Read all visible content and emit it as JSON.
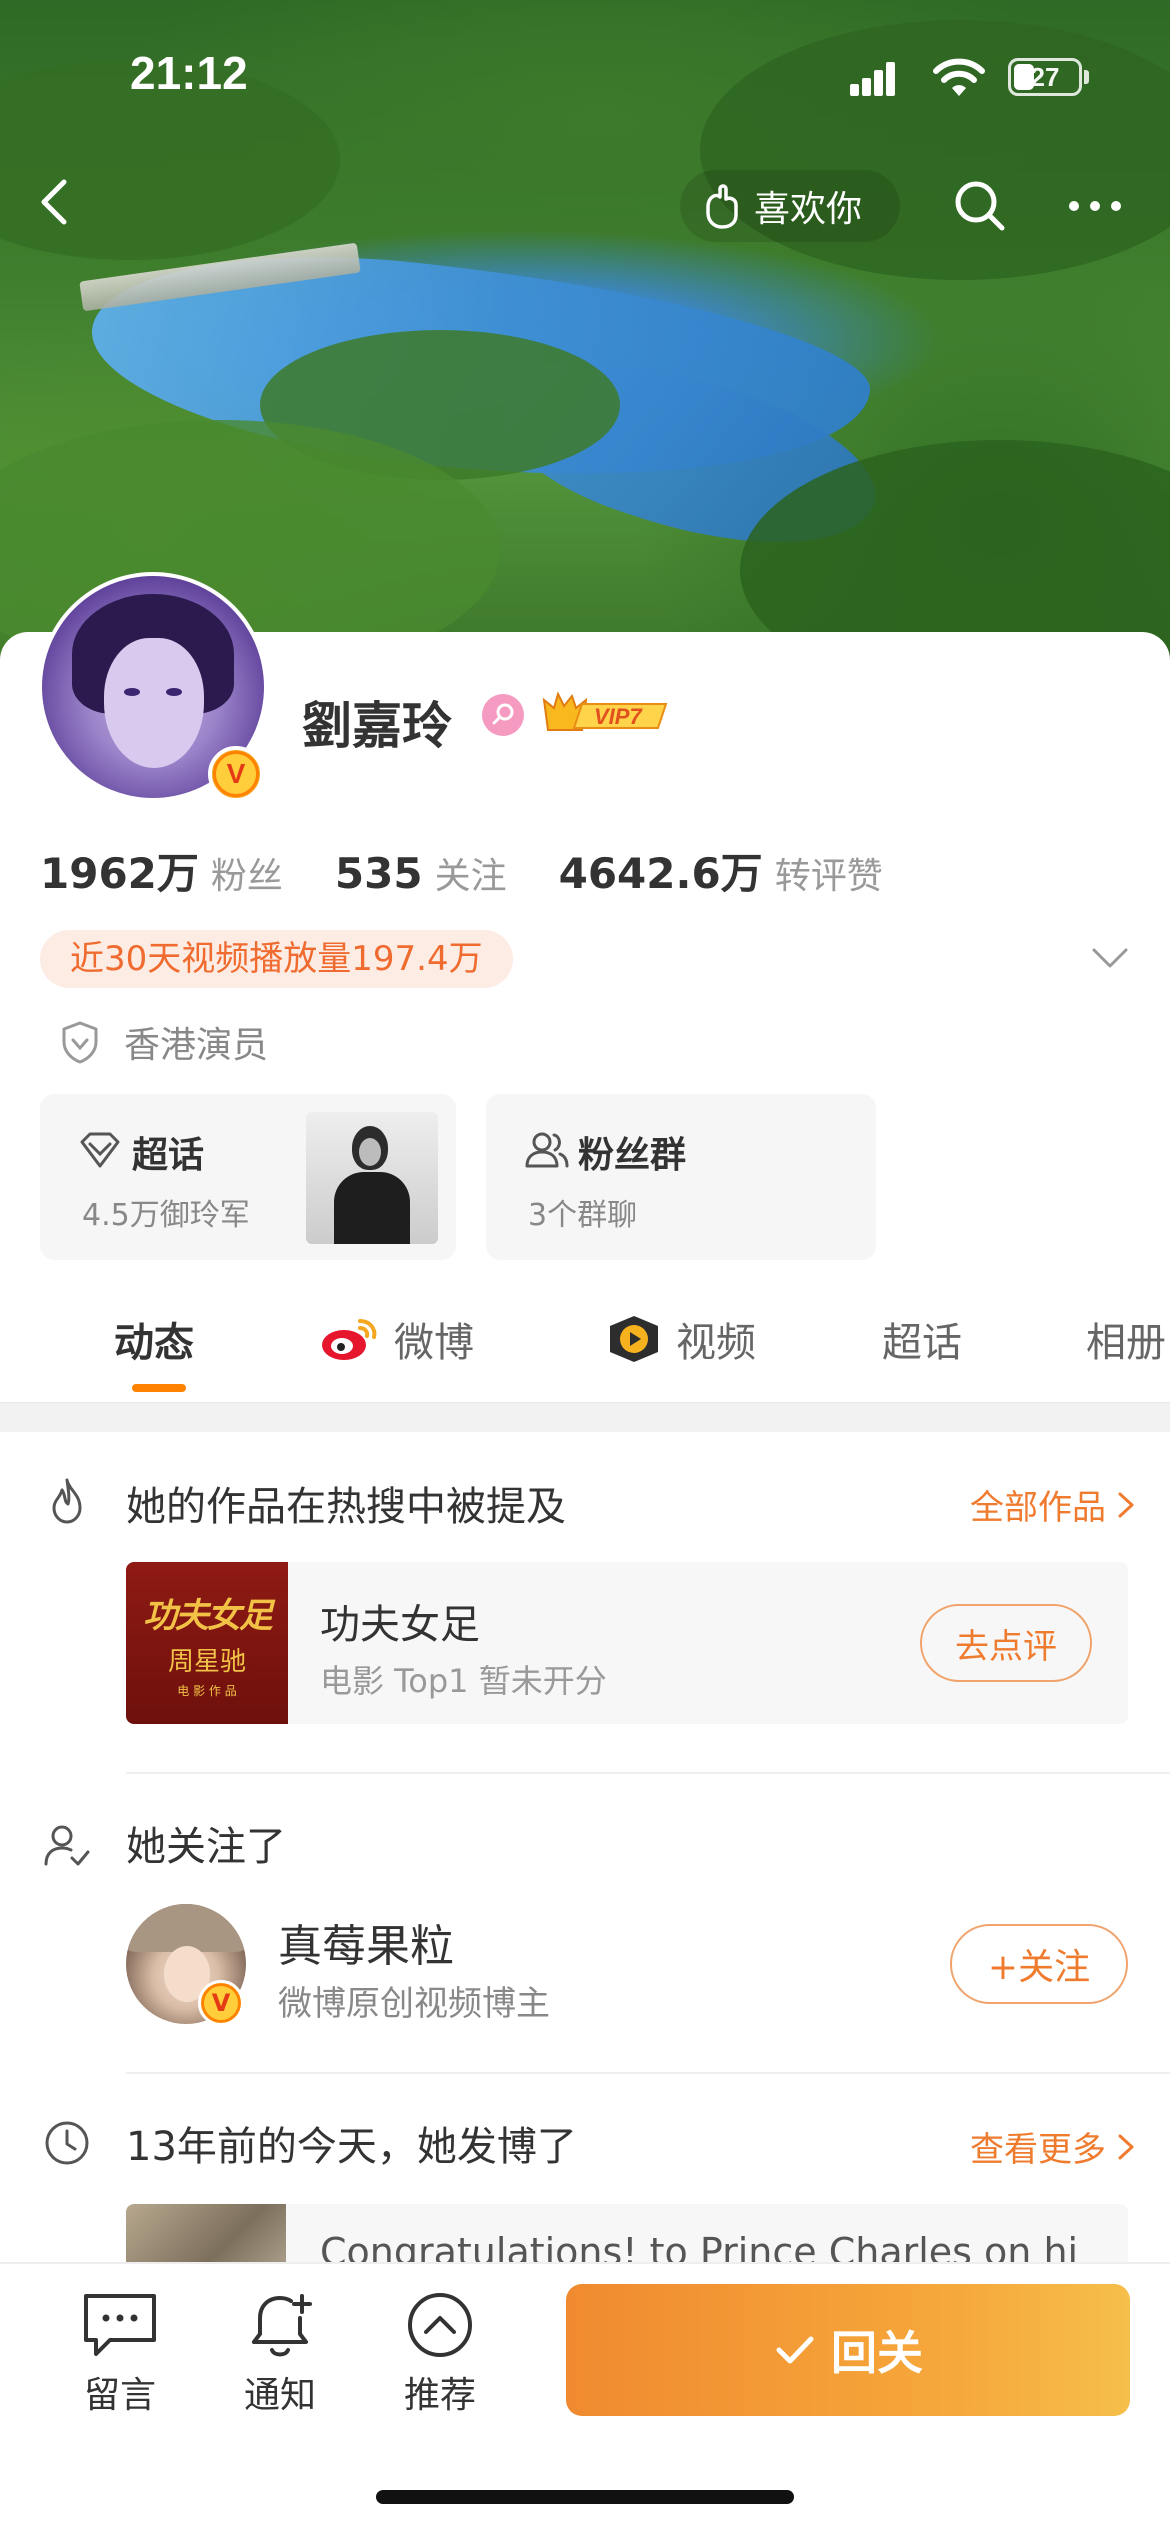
{
  "status_bar": {
    "time": "21:12",
    "battery": "27"
  },
  "header": {
    "like_label": "喜欢你"
  },
  "profile": {
    "name": "劉嘉玲",
    "vip_label": "VIP7",
    "verified_mark": "V",
    "stats": [
      {
        "value": "1962万",
        "label": "粉丝"
      },
      {
        "value": "535",
        "label": "关注"
      },
      {
        "value": "4642.6万",
        "label": "转评赞"
      }
    ],
    "video_plays": "近30天视频播放量197.4万",
    "tag": "香港演员"
  },
  "entries": {
    "supertopic": {
      "title": "超话",
      "sub": "4.5万御玲军"
    },
    "fan_group": {
      "title": "粉丝群",
      "sub": "3个群聊"
    }
  },
  "tabs": [
    {
      "label": "动态"
    },
    {
      "label": "微博"
    },
    {
      "label": "视频"
    },
    {
      "label": "超话"
    },
    {
      "label": "相册"
    }
  ],
  "works_section": {
    "title": "她的作品在热搜中被提及",
    "link": "全部作品",
    "work": {
      "poster_title": "功夫女足",
      "poster_director": "周星驰",
      "poster_tiny": "电 影 作 品",
      "name": "功夫女足",
      "meta": "电影 Top1 暂未开分",
      "button": "去点评"
    }
  },
  "following_section": {
    "title": "她关注了",
    "user": {
      "name": "真莓果粒",
      "desc": "微博原创视频博主",
      "verified_mark": "V",
      "button": "+关注"
    }
  },
  "memory_section": {
    "title": "13年前的今天，她发博了",
    "link": "查看更多",
    "post_text": "Congratulations! to Prince Charles on hi"
  },
  "bottom_bar": {
    "items": [
      {
        "label": "留言",
        "icon": "message-icon"
      },
      {
        "label": "通知",
        "icon": "bell-plus-icon"
      },
      {
        "label": "推荐",
        "icon": "chevron-up-circle-icon"
      }
    ],
    "primary_button": "回关"
  }
}
